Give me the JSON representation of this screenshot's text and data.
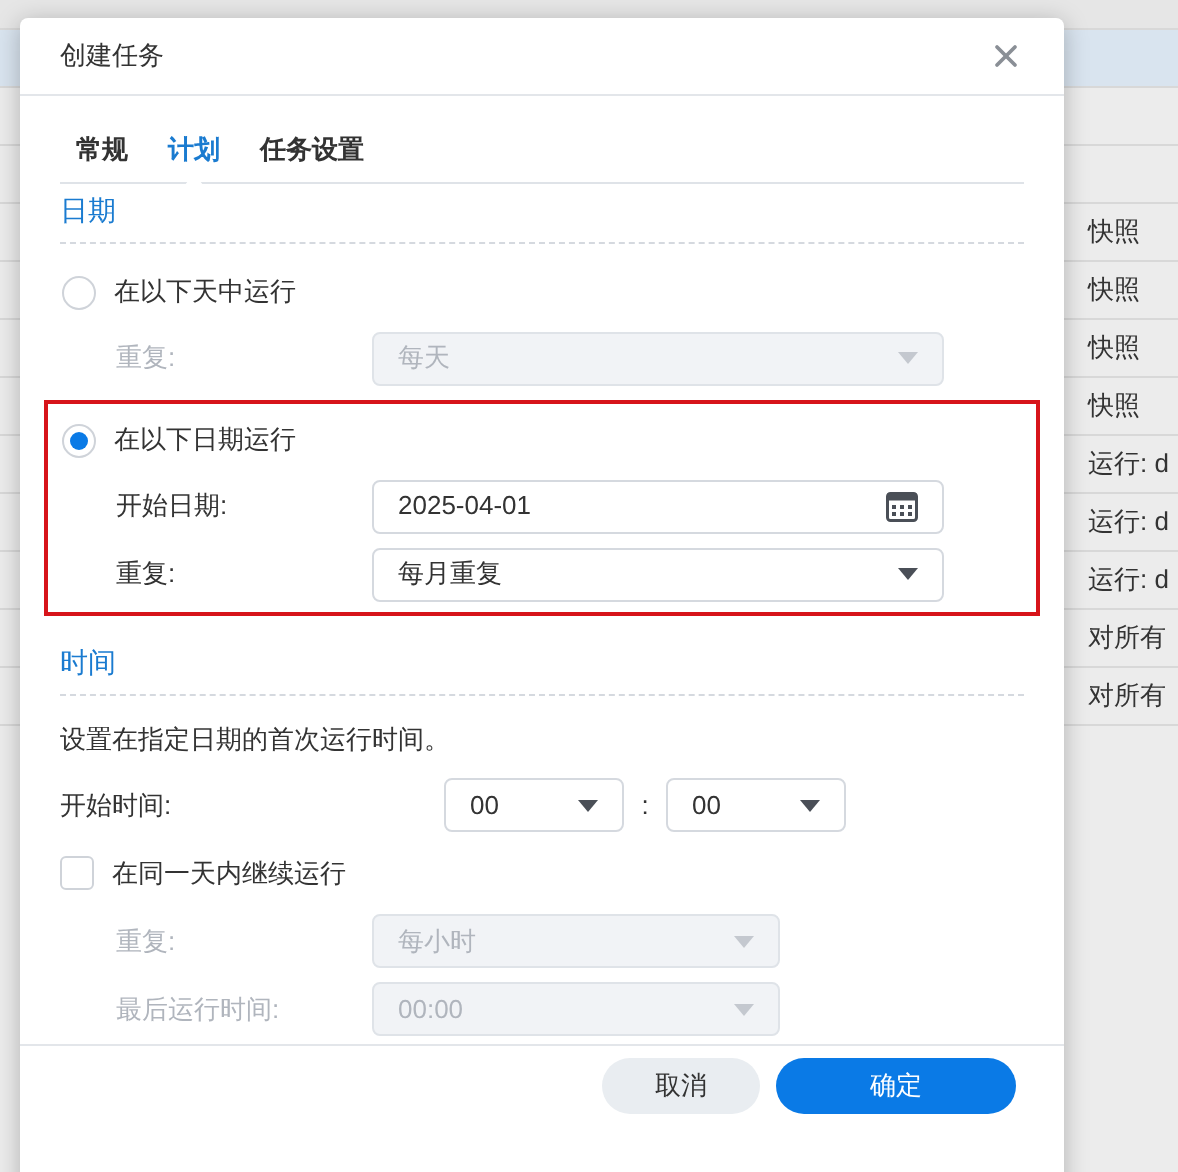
{
  "background_table": {
    "rows": [
      {
        "selected": true
      },
      {
        "selected": false
      },
      {
        "selected": false
      },
      {
        "selected": false,
        "action": "快照"
      },
      {
        "selected": false,
        "action": "快照"
      },
      {
        "selected": false,
        "action": "快照"
      },
      {
        "selected": false,
        "action": "快照"
      },
      {
        "selected": false,
        "action": "运行: d"
      },
      {
        "selected": false,
        "action": "运行: d"
      },
      {
        "selected": false,
        "action": "运行: d"
      },
      {
        "selected": false,
        "action": "对所有"
      },
      {
        "selected": false,
        "action": "对所有"
      }
    ]
  },
  "dialog": {
    "title": "创建任务",
    "tabs": [
      {
        "label": "常规",
        "selected": false
      },
      {
        "label": "计划",
        "selected": true
      },
      {
        "label": "任务设置",
        "selected": false
      }
    ],
    "date_section": {
      "title": "日期",
      "options": [
        {
          "label": "在以下天中运行",
          "selected": false,
          "fields": [
            {
              "label": "重复:",
              "kind": "select",
              "value": "每天"
            }
          ]
        },
        {
          "label": "在以下日期运行",
          "selected": true,
          "highlighted": true,
          "fields": [
            {
              "label": "开始日期:",
              "kind": "date",
              "value": "2025-04-01"
            },
            {
              "label": "重复:",
              "kind": "select",
              "value": "每月重复"
            }
          ]
        }
      ]
    },
    "time_section": {
      "title": "时间",
      "description": "设置在指定日期的首次运行时间。",
      "start_time": {
        "label": "开始时间:",
        "hour": "00",
        "separator": ":",
        "minute": "00"
      },
      "continue": {
        "label": "在同一天内继续运行",
        "checked": false,
        "fields": [
          {
            "label": "重复:",
            "value": "每小时"
          },
          {
            "label": "最后运行时间:",
            "value": "00:00"
          }
        ]
      }
    },
    "buttons": [
      {
        "label": "取消",
        "kind": "secondary"
      },
      {
        "label": "确定",
        "kind": "primary"
      }
    ]
  }
}
